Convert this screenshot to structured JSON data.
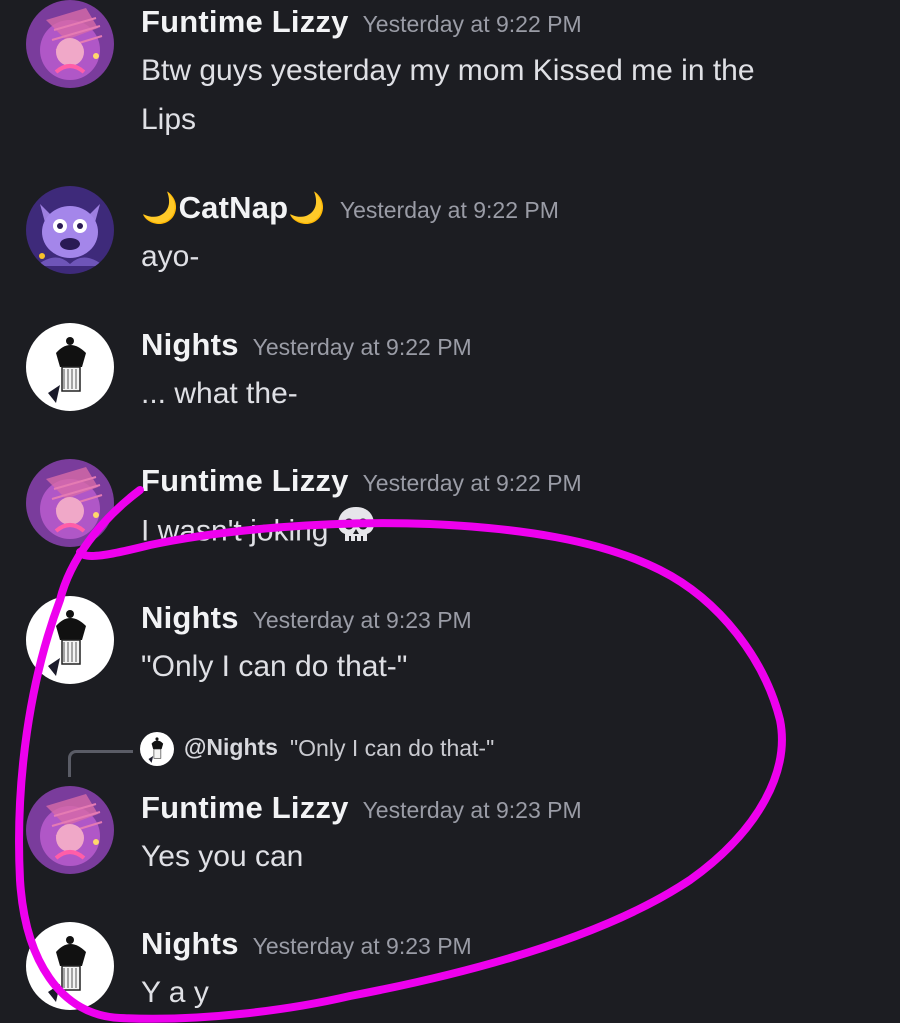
{
  "messages": [
    {
      "username": "Funtime Lizzy",
      "timestamp": "Yesterday at 9:22 PM",
      "lines": [
        "Btw guys yesterday my mom Kissed me in the",
        "Lips"
      ]
    },
    {
      "username_prefix": "🌙",
      "username": "CatNap",
      "username_suffix": "🌙",
      "timestamp": "Yesterday at 9:22 PM",
      "lines": [
        "ayo-"
      ]
    },
    {
      "username": "Nights",
      "timestamp": "Yesterday at 9:22 PM",
      "lines": [
        "... what the-"
      ]
    },
    {
      "username": "Funtime Lizzy",
      "timestamp": "Yesterday at 9:22 PM",
      "lines": [
        "I wasn't joking"
      ],
      "emoji": "skull-emoji"
    },
    {
      "username": "Nights",
      "timestamp": "Yesterday at 9:23 PM",
      "lines": [
        "\"Only I can do that-\""
      ]
    },
    {
      "username": "Funtime Lizzy",
      "timestamp": "Yesterday at 9:23 PM",
      "lines": [
        "Yes you can"
      ],
      "reply": {
        "mention": "@Nights",
        "text": "\"Only I can do that-\""
      }
    },
    {
      "username": "Nights",
      "timestamp": "Yesterday at 9:23 PM",
      "lines": [
        "Y a y"
      ]
    }
  ],
  "colors": {
    "background": "#1c1d22",
    "username": "#f2f3f5",
    "timestamp": "#9a9ca6",
    "message_text": "#dfe0e5",
    "annotation_stroke": "#ee00ee",
    "moon_emoji": "#f7c02a"
  },
  "icons": {
    "funtime_lizzy_avatar": "pink-purple-character-avatar",
    "catnap_avatar": "purple-cat-avatar",
    "nights_avatar": "white-black-hair-character-avatar",
    "emoji": "skull-emoji"
  }
}
